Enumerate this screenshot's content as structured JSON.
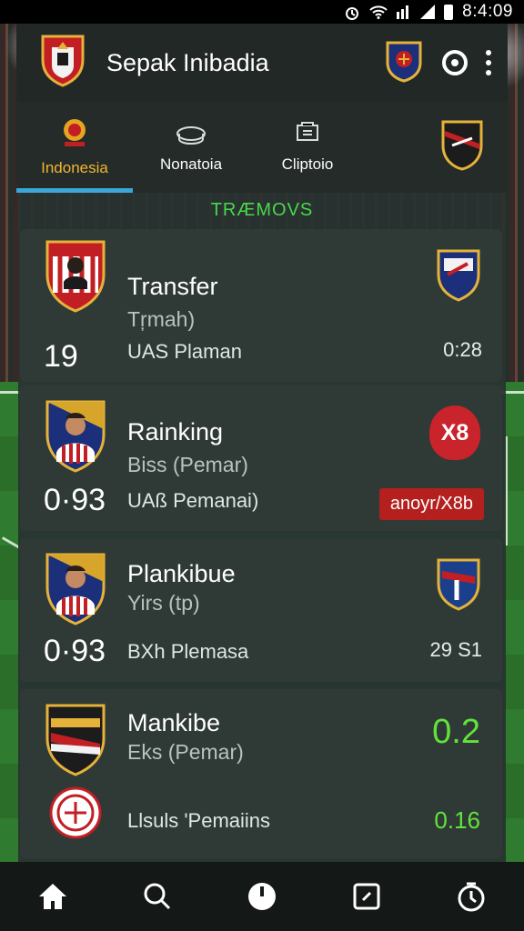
{
  "status_bar": {
    "time": "8:4:09"
  },
  "app_bar": {
    "title": "Sepak Inibadia"
  },
  "tabs": [
    {
      "label": "Indonesia",
      "icon": "flame-crest-icon",
      "active": true
    },
    {
      "label": "Nonatoia",
      "icon": "stadium-icon",
      "active": false
    },
    {
      "label": "Cliptoio",
      "icon": "trophy-icon",
      "active": false
    },
    {
      "label": "",
      "icon": "club-crest-icon",
      "active": false
    }
  ],
  "section": {
    "title": "TRÆMOVS"
  },
  "cards": [
    {
      "name": "Transfer",
      "sub": "Tŗmah)",
      "num": "19",
      "league": "UAS Plaman",
      "right_value": "0:28"
    },
    {
      "name": "Rainking",
      "sub": "Biss (Pemar)",
      "num": "0·93",
      "league": "UAß Pemanai)",
      "score": "X8",
      "badge": "anoyr/X8b"
    },
    {
      "name": "Plankibue",
      "sub": "Yirs (tp)",
      "num": "0·93",
      "league": "BXh Plemasa",
      "right_value": "29 S1"
    },
    {
      "name": "Mankibe",
      "sub": "Eks (Pemar)",
      "green_big": "0.2",
      "league": "Llsuls 'Pemaiins",
      "green_small": "0.16"
    }
  ],
  "bottom_nav": [
    {
      "icon": "home-icon"
    },
    {
      "icon": "search-icon"
    },
    {
      "icon": "clock-icon"
    },
    {
      "icon": "square-icon"
    },
    {
      "icon": "timer-icon"
    }
  ],
  "colors": {
    "accent_tab": "#f2b531",
    "tab_indicator": "#3aa7d6",
    "section_green": "#49d84a",
    "value_green": "#62e33a",
    "badge_red": "#b3201e"
  }
}
